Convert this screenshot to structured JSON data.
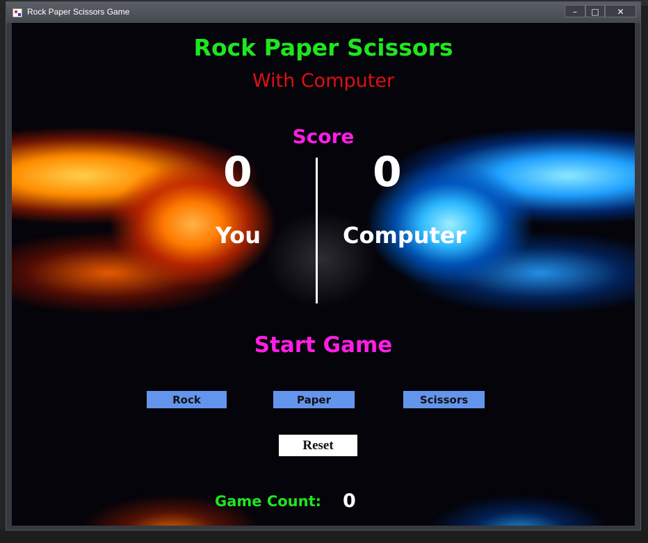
{
  "window": {
    "title": "Rock Paper Scissors Game",
    "controls": {
      "minimize": "–",
      "maximize": "□",
      "close": "✕"
    }
  },
  "game": {
    "title": "Rock Paper Scissors",
    "subtitle": "With Computer",
    "score_label": "Score",
    "player_score": "0",
    "computer_score": "0",
    "player_label": "You",
    "computer_label": "Computer",
    "start_label": "Start Game"
  },
  "buttons": {
    "rock": "Rock",
    "paper": "Paper",
    "scissors": "Scissors",
    "reset": "Reset"
  },
  "footer": {
    "game_count_label": "Game Count:",
    "game_count_value": "0"
  },
  "colors": {
    "title": "#1ee61e",
    "subtitle": "#e01010",
    "accent_magenta": "#ff1ee6",
    "button_blue": "#6495ed"
  }
}
